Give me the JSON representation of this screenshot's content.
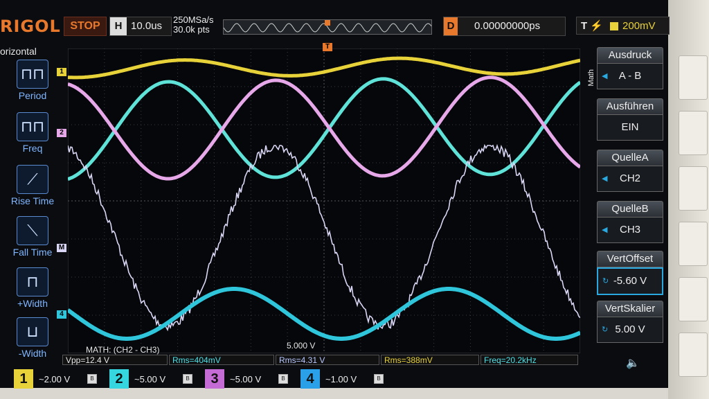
{
  "header": {
    "brand": "RIGOL",
    "run_state": "STOP",
    "horiz_label": "H",
    "timebase": "10.0us",
    "sample_rate": "250MSa/s",
    "memory_depth": "30.0k pts",
    "delay_label": "D",
    "delay_value": "0.00000000ps",
    "trigger_label": "T",
    "trigger_level": "200mV"
  },
  "left_menu": {
    "title": "orizontal",
    "items": [
      {
        "label": "Period",
        "icon": "period-icon"
      },
      {
        "label": "Freq",
        "icon": "freq-icon"
      },
      {
        "label": "Rise Time",
        "icon": "rise-time-icon"
      },
      {
        "label": "Fall Time",
        "icon": "fall-time-icon"
      },
      {
        "label": "+Width",
        "icon": "pos-width-icon"
      },
      {
        "label": "-Width",
        "icon": "neg-width-icon"
      }
    ]
  },
  "screen": {
    "math_label": "MATH: (CH2 - CH3)",
    "math_scale": "5.000 V",
    "markers": {
      "ch1": "1",
      "ch2": "2",
      "math": "M",
      "ch4": "4"
    }
  },
  "measurements": [
    {
      "text": "Vpp=12.4 V",
      "color": "#e6e6e6"
    },
    {
      "text": "Rms=404mV",
      "color": "#4fe0e6"
    },
    {
      "text": "Rms=4.31 V",
      "color": "#b9c8ff"
    },
    {
      "text": "Rms=388mV",
      "color": "#e8d23a"
    },
    {
      "text": "Freq=20.2kHz",
      "color": "#4fe0e6"
    }
  ],
  "channels": [
    {
      "num": "1",
      "scale": "2.00 V",
      "color": "#e8d23a"
    },
    {
      "num": "2",
      "scale": "5.00 V",
      "color": "#36d6e0"
    },
    {
      "num": "3",
      "scale": "5.00 V",
      "color": "#c56bd6"
    },
    {
      "num": "4",
      "scale": "1.00 V",
      "color": "#2aa0e8"
    }
  ],
  "right_menu": {
    "side_label": "Math",
    "items": [
      {
        "title": "Ausdruck",
        "value": "A - B"
      },
      {
        "title": "Ausführen",
        "value": "EIN"
      },
      {
        "title": "QuelleA",
        "value": "CH2"
      },
      {
        "title": "QuelleB",
        "value": "CH3"
      },
      {
        "title": "VertOffset",
        "value": "-5.60 V"
      },
      {
        "title": "VertSkalier",
        "value": "5.00 V"
      }
    ]
  },
  "colors": {
    "ch1": "#e8d23a",
    "ch2": "#5fe3d8",
    "ch3": "#e6a8e8",
    "ch4": "#2fc6dc",
    "math": "#d8d6f4"
  }
}
